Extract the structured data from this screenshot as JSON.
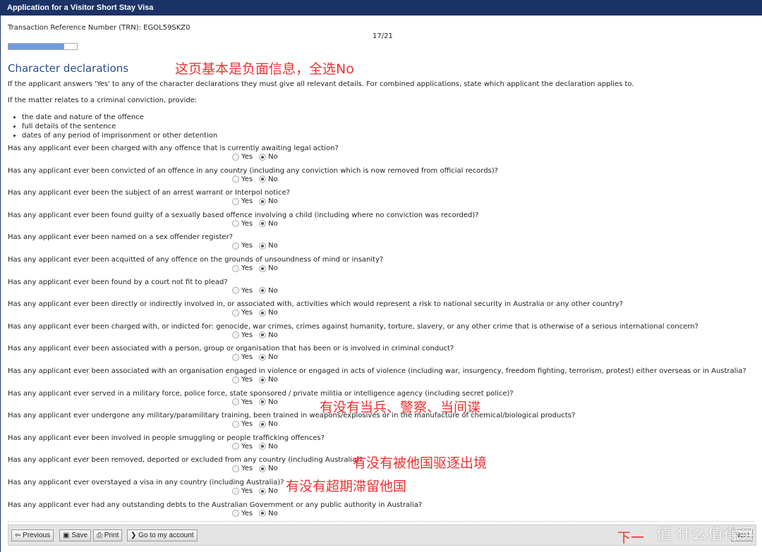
{
  "window": {
    "title": "Application for a Visitor Short Stay Visa"
  },
  "header": {
    "trn": "Transaction Reference Number (TRN): EGOL59SKZ0",
    "page_indicator": "17/21",
    "progress_percent": 81
  },
  "section": {
    "title": "Character declarations",
    "intro": "If the applicant answers  'Yes'  to any of the character declarations they must give all relevant details. For combined applications, state which applicant the declaration applies to.",
    "criminal_intro": "If the matter relates to a criminal conviction, provide:",
    "bullets": [
      "the date and nature of the offence",
      "full details of the sentence",
      "dates of any period of imprisonment or other detention"
    ]
  },
  "radio_labels": {
    "yes": "Yes",
    "no": "No"
  },
  "questions": [
    {
      "text": "Has any applicant ever been charged with any offence that is currently awaiting legal action?",
      "answer": "No"
    },
    {
      "text": "Has any applicant ever been convicted of an offence in any country (including any conviction which is now removed from official records)?",
      "answer": "No"
    },
    {
      "text": "Has any applicant ever been the subject of an arrest warrant or Interpol notice?",
      "answer": "No"
    },
    {
      "text": "Has any applicant ever been found guilty of a sexually based offence involving a child (including where no conviction was recorded)?",
      "answer": "No"
    },
    {
      "text": "Has any applicant ever been named on a sex offender register?",
      "answer": "No"
    },
    {
      "text": "Has any applicant ever been acquitted of any offence on the grounds of unsoundness of mind or insanity?",
      "answer": "No"
    },
    {
      "text": "Has any applicant ever been found by a court not fit to plead?",
      "answer": "No"
    },
    {
      "text": "Has any applicant ever been directly or indirectly involved in, or associated with, activities which would represent a risk to national security in Australia or any other country?",
      "answer": "No"
    },
    {
      "text": "Has any applicant ever been charged with, or indicted for: genocide, war crimes, crimes against humanity, torture, slavery, or any other crime that is otherwise of a serious international concern?",
      "answer": "No"
    },
    {
      "text": "Has any applicant ever been associated with a person, group or organisation that has been or is involved in criminal conduct?",
      "answer": "No"
    },
    {
      "text": "Has any applicant ever been associated with an organisation engaged in violence or engaged in acts of violence (including war, insurgency, freedom fighting, terrorism, protest) either overseas or in Australia?",
      "answer": "No"
    },
    {
      "text": "Has any applicant ever served in a military force, police force, state sponsored / private militia or intelligence agency (including secret police)?",
      "answer": "No"
    },
    {
      "text": "Has any applicant ever undergone any military/paramilitary training, been trained in weapons/explosives or in the manufacture of chemical/biological products?",
      "answer": "No"
    },
    {
      "text": "Has any applicant ever been involved in people smuggling or people trafficking offences?",
      "answer": "No"
    },
    {
      "text": "Has any applicant ever been removed, deported or excluded from any country (including Australia)?",
      "answer": "No"
    },
    {
      "text": "Has any applicant ever overstayed a visa in any country (including Australia)?",
      "answer": "No"
    },
    {
      "text": "Has any applicant ever had any outstanding debts to the Australian Government or any public authority in Australia?",
      "answer": "No"
    }
  ],
  "footer": {
    "previous": "Previous",
    "save": "Save",
    "print": "Print",
    "account": "Go to my account",
    "next": "Next"
  },
  "annotations": {
    "top": "这页基本是负面信息，全选No",
    "military": "有没有当兵、警察、当间谍",
    "deported": "有没有被他国驱逐出境",
    "overstay": "有没有超期滞留他国",
    "next": "下一"
  },
  "watermark": "值 什么值得买",
  "colors": {
    "titlebar": "#1b3366",
    "heading": "#2a4f8a",
    "progress": "#6f9ce0",
    "annotation": "#f03030"
  }
}
